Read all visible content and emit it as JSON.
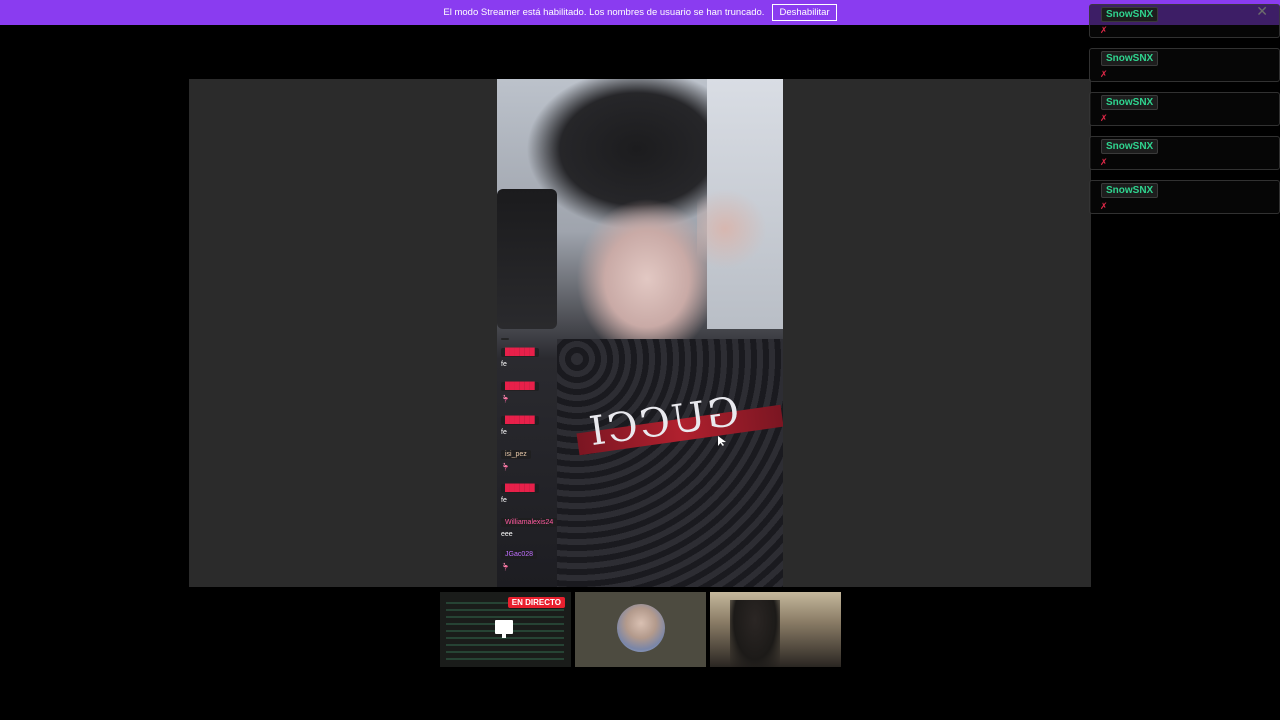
{
  "banner": {
    "text": "El modo Streamer está habilitado. Los nombres de usuario se han truncado.",
    "button_label": "Deshabilitar",
    "close_glyph": "✕"
  },
  "mini_chat": {
    "items": [
      {
        "name": "",
        "color": "#ff4a8a",
        "msg": ""
      },
      {
        "name": "██████",
        "color": "#e8204a",
        "msg": "fe"
      },
      {
        "name": "██████",
        "color": "#e8204a",
        "msg": "🦩"
      },
      {
        "name": "██████",
        "color": "#e8204a",
        "msg": "fe"
      },
      {
        "name": "isi_pez",
        "color": "#e8c9a8",
        "msg": "🦩"
      },
      {
        "name": "██████",
        "color": "#e8204a",
        "msg": "fe"
      },
      {
        "name": "Williamalexis24",
        "color": "#ff5aa0",
        "msg": "eee"
      },
      {
        "name": "JGac028",
        "color": "#c070ff",
        "msg": "🦩"
      }
    ]
  },
  "thumbnails": {
    "live_label": "EN DIRECTO"
  },
  "side_chat": {
    "items": [
      {
        "name": "SnowSNX",
        "icon": "✗"
      },
      {
        "name": "SnowSNX",
        "icon": "✗"
      },
      {
        "name": "SnowSNX",
        "icon": "✗"
      },
      {
        "name": "SnowSNX",
        "icon": "✗"
      },
      {
        "name": "SnowSNX",
        "icon": "✗"
      }
    ]
  },
  "video": {
    "shirt_text": "GUCCI"
  }
}
